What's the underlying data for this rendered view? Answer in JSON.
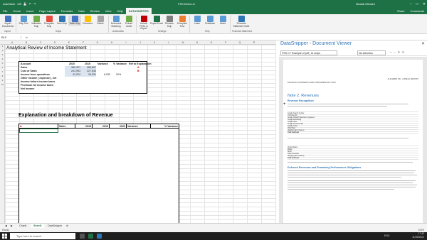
{
  "titlebar": {
    "autosave": "AutoSave",
    "autosave_state": "Off",
    "document": "FSS Demo.xl",
    "user": "Nicolai Ottosen"
  },
  "tabs": {
    "items": [
      "File",
      "Home",
      "Insert",
      "Page Layout",
      "Formulas",
      "Data",
      "Review",
      "View",
      "Help",
      "DATASNIPPER"
    ],
    "share": "Share",
    "comments": "Comments"
  },
  "ribbon": {
    "buttons": [
      "Import Documents",
      "Snip Text",
      "Validation Snip",
      "Exception Snip",
      "Sum Snip",
      "Table Snip",
      "Comment",
      "Delete",
      "Document Matching",
      "Extract Limits",
      "Include PDFs in Export",
      "Export Excel",
      "Rename Snip",
      "Exception Flow",
      "Learn",
      "Feedback",
      "About",
      "Financial Statement Suite"
    ],
    "groups": [
      "Import",
      "Snips",
      "Automation",
      "Settings",
      "Help",
      "Financial Statement"
    ]
  },
  "formula_bar": {
    "namebox": "B10",
    "fx": "fx"
  },
  "columns": [
    "A",
    "B",
    "C",
    "D",
    "E",
    "F",
    "G",
    "H",
    "I",
    "J",
    "K",
    "L",
    "M",
    "N",
    "O",
    "P",
    "Q",
    "R"
  ],
  "sheet": {
    "title": "Analytical Review of Income Statement",
    "table1": {
      "headers": [
        "Account",
        "2020",
        "2019",
        "Variance",
        "% Variance",
        "Ref to Explanation"
      ],
      "rows": [
        {
          "label": "Sales",
          "y2020": "382,327",
          "y2019": "365,857",
          "variance": "",
          "pct": "",
          "ref": "A"
        },
        {
          "label": "Cost of Sales",
          "y2020": "241,903",
          "y2019": "227,634",
          "variance": "",
          "pct": "",
          "ref": "B"
        },
        {
          "label": "Income from operations",
          "y2020": "41,224",
          "y2019": "34,291",
          "variance": "6,933",
          "pct": "20%",
          "ref": ""
        },
        {
          "label": "Other income ( expense) , net",
          "y2020": "",
          "y2019": "",
          "variance": "",
          "pct": "",
          "ref": ""
        },
        {
          "label": "Income before income taxes",
          "y2020": "",
          "y2019": "",
          "variance": "",
          "pct": "",
          "ref": ""
        },
        {
          "label": "Provision for income taxes",
          "y2020": "",
          "y2019": "",
          "variance": "",
          "pct": "",
          "ref": ""
        },
        {
          "label": "Net income",
          "y2020": "",
          "y2019": "",
          "variance": "",
          "pct": "",
          "ref": ""
        }
      ]
    },
    "section_title": "Explanation and breakdown of Revenue",
    "table2": {
      "headers": [
        "A",
        "Sales",
        "2018",
        "2019",
        "2020",
        "Variance",
        "% Variance"
      ]
    }
  },
  "docviewer": {
    "title": "DataSnipper - Document Viewer",
    "doc_select": "FSS CY Example of pdf | 11 snips",
    "selection": "No selection",
    "page": {
      "header_right": "ALPHABET INC. | ANNUAL REPORT",
      "subtitle": "FINANCIAL STATEMENTS AND SUPPLEMENTARY DATA",
      "note": "Note 2.   Revenues",
      "subhead": "Revenue Recognition",
      "table_rows": [
        "Google Search & other",
        "YouTube ads",
        "Google Network Members' properties",
        "Google advertising",
        "Google other",
        "Google Services total",
        "Google Cloud",
        "Other Bets",
        "Hedging gains (losses)",
        "Total revenues"
      ],
      "table_rows_2": [
        "United States",
        "EMEA",
        "APAC",
        "Other Americas",
        "Hedging gains (losses)",
        "Total revenues"
      ],
      "section2": "Deferred Revenues and Remaining Performance Obligations"
    }
  },
  "sheettabs": [
    "Chart1",
    "Sheet1",
    "DataSnipper"
  ],
  "status": {
    "left": "Ready",
    "zoom": "100%"
  },
  "taskbar": {
    "search": "Type here to search",
    "time": "17:42",
    "date": "11/05/2021",
    "lang": "ENG"
  },
  "colors": {
    "excel_green": "#1e7145",
    "accent_blue": "#2e75b6",
    "highlight": "#dbe5f1",
    "ref_red": "#c00000"
  }
}
